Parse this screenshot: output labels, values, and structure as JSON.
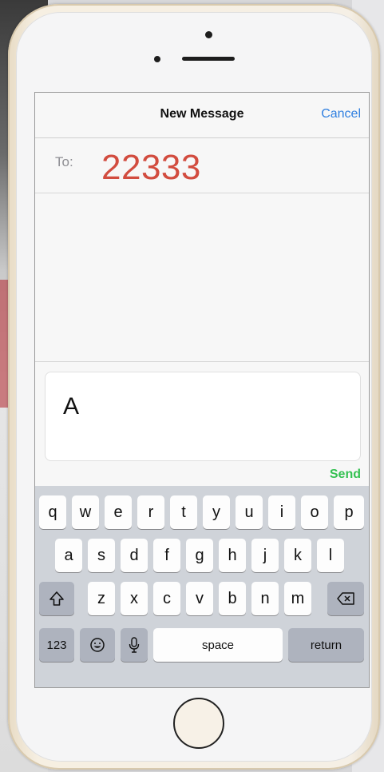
{
  "header": {
    "title": "New Message",
    "cancel_label": "Cancel"
  },
  "recipient": {
    "label": "To:",
    "value": "22333"
  },
  "composer": {
    "text": "A",
    "send_label": "Send"
  },
  "keyboard": {
    "row1": [
      "q",
      "w",
      "e",
      "r",
      "t",
      "y",
      "u",
      "i",
      "o",
      "p"
    ],
    "row2": [
      "a",
      "s",
      "d",
      "f",
      "g",
      "h",
      "j",
      "k",
      "l"
    ],
    "row3": [
      "z",
      "x",
      "c",
      "v",
      "b",
      "n",
      "m"
    ],
    "numbers_label": "123",
    "space_label": "space",
    "return_label": "return",
    "icons": {
      "shift": "shift-icon",
      "backspace": "backspace-icon",
      "emoji": "emoji-icon",
      "mic": "mic-icon"
    }
  },
  "colors": {
    "accent_blue": "#2f7fe0",
    "send_green": "#35c152",
    "recipient_red": "#d24c3f"
  }
}
